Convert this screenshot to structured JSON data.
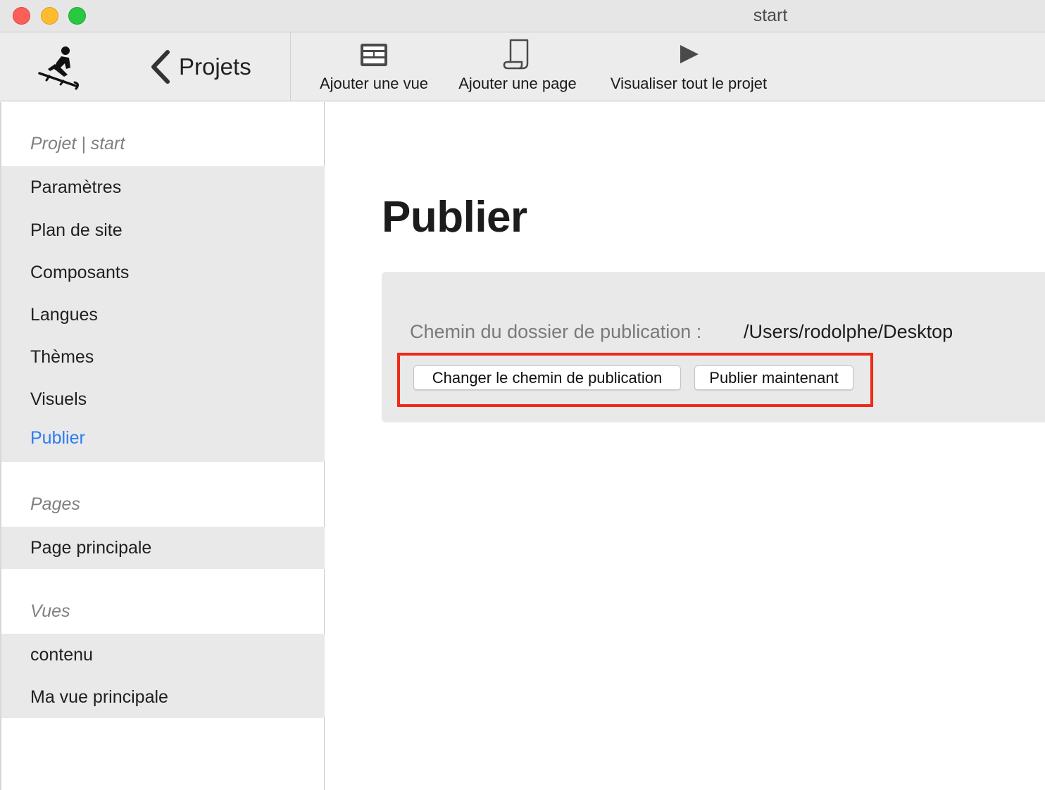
{
  "window": {
    "title": "start"
  },
  "toolbar": {
    "back_label": "Projets",
    "add_view_label": "Ajouter une vue",
    "add_page_label": "Ajouter une page",
    "preview_label": "Visualiser tout le projet"
  },
  "sidebar": {
    "project_header": "Projet | start",
    "project_items": [
      {
        "label": "Paramètres"
      },
      {
        "label": "Plan de site"
      },
      {
        "label": "Composants"
      },
      {
        "label": "Langues"
      },
      {
        "label": "Thèmes"
      },
      {
        "label": "Visuels"
      },
      {
        "label": "Publier",
        "active": true
      }
    ],
    "pages_header": "Pages",
    "pages_items": [
      {
        "label": "Page principale"
      }
    ],
    "views_header": "Vues",
    "views_items": [
      {
        "label": "contenu"
      },
      {
        "label": "Ma vue principale"
      }
    ]
  },
  "main": {
    "title": "Publier",
    "path_label": "Chemin du dossier de publication :",
    "path_value": "/Users/rodolphe/Desktop",
    "change_path_button": "Changer le chemin de publication",
    "publish_button": "Publier maintenant"
  },
  "colors": {
    "accent": "#2b7cf0",
    "highlight": "#f02a17"
  }
}
